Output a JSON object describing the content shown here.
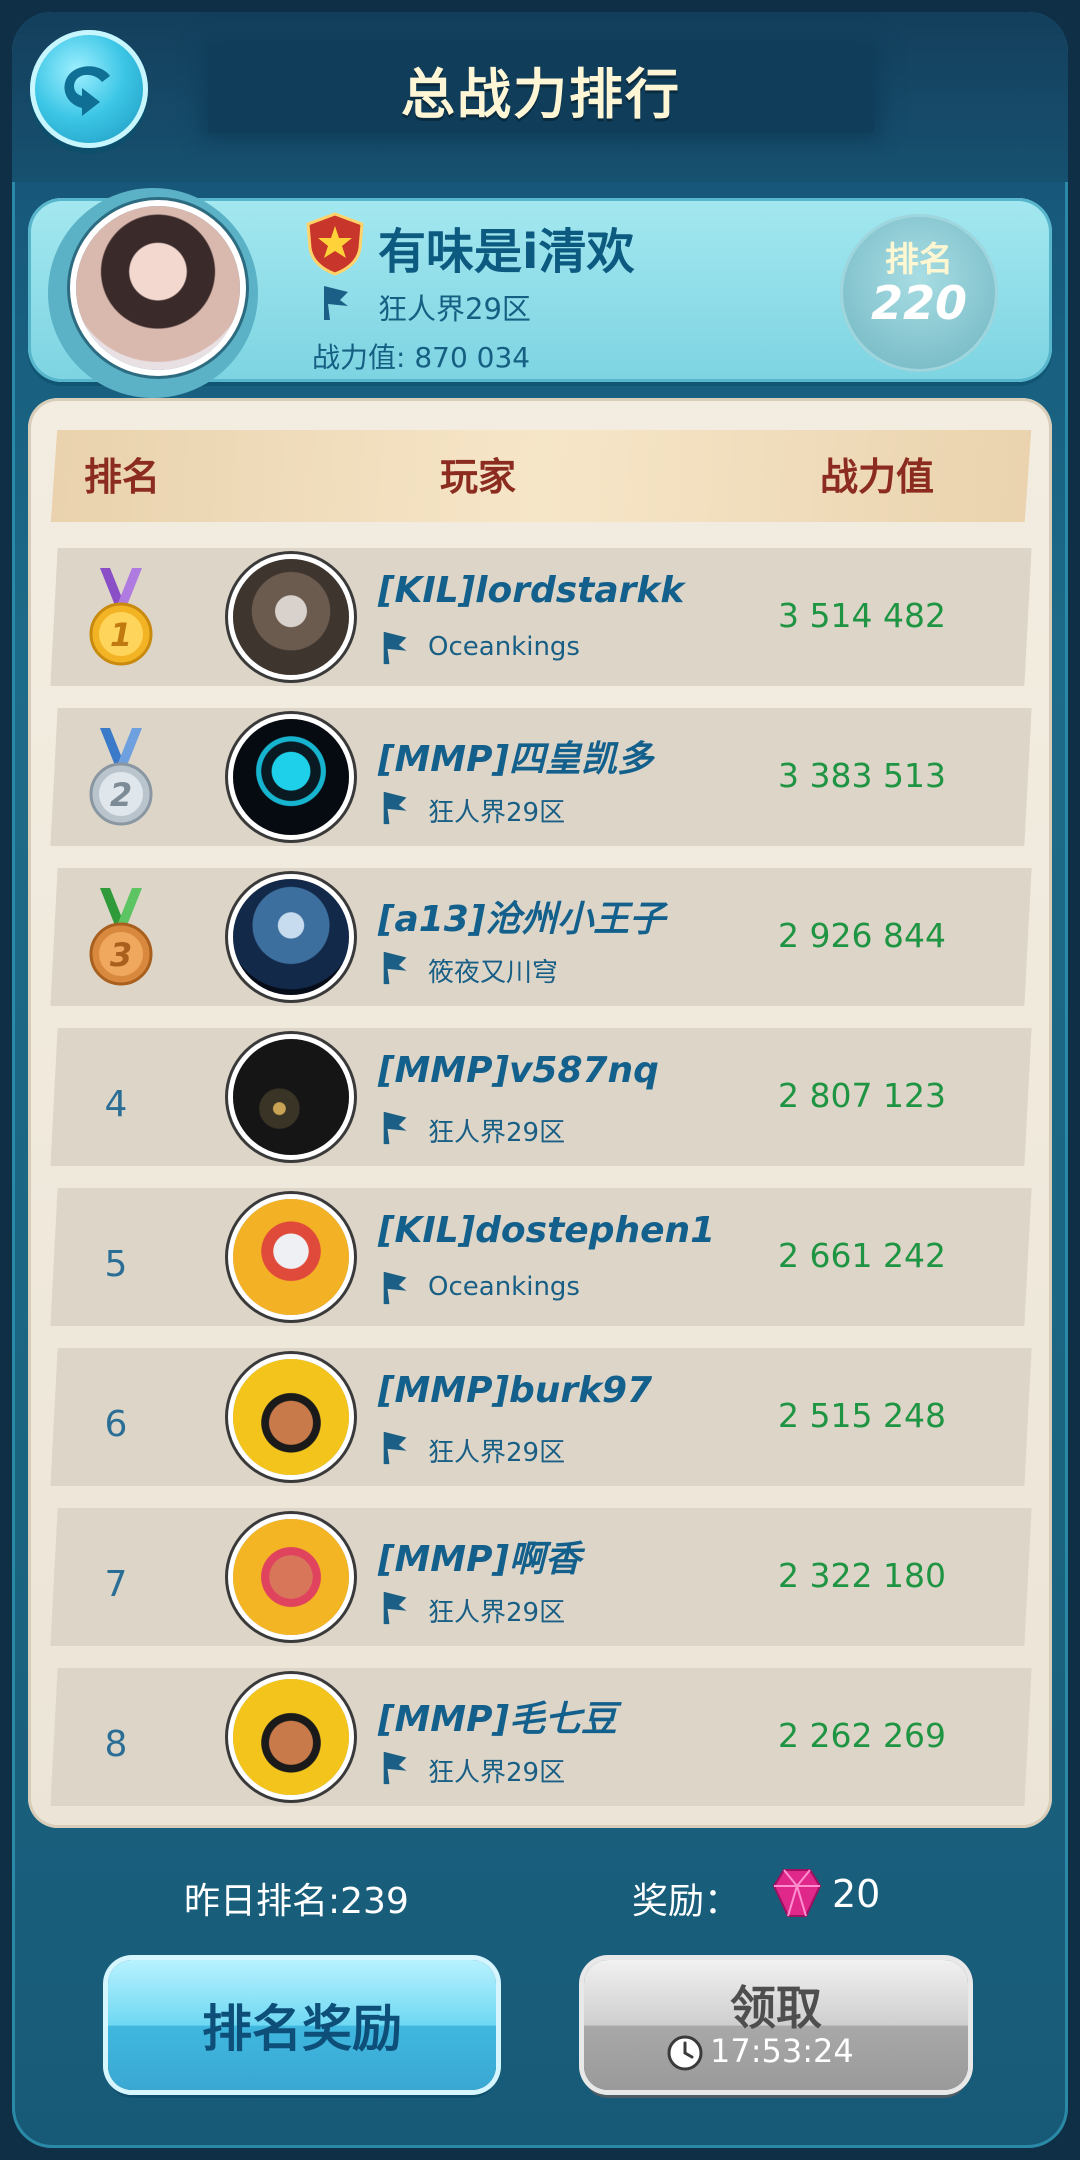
{
  "header": {
    "title": "总战力排行",
    "back_icon": "back-arrow-icon"
  },
  "me": {
    "name": "有味是i清欢",
    "server": "狂人界29区",
    "power": "战力值: 870 034",
    "rank_label": "排名",
    "rank_value": "220"
  },
  "table": {
    "headers": {
      "rank": "排名",
      "player": "玩家",
      "power": "战力值"
    },
    "rows": [
      {
        "rank": "1",
        "medal": "gold",
        "name": "[KIL]lordstarkk",
        "server": "Oceankings",
        "power": "3 514 482"
      },
      {
        "rank": "2",
        "medal": "silver",
        "name": "[MMP]四皇凯多",
        "server": "狂人界29区",
        "power": "3 383 513"
      },
      {
        "rank": "3",
        "medal": "bronze",
        "name": "[a13]沧州小王子",
        "server": "筱夜又川穹",
        "power": "2 926 844"
      },
      {
        "rank": "4",
        "medal": "",
        "name": "[MMP]v587nq",
        "server": "狂人界29区",
        "power": "2 807 123"
      },
      {
        "rank": "5",
        "medal": "",
        "name": "[KIL]dostephen1",
        "server": "Oceankings",
        "power": "2 661 242"
      },
      {
        "rank": "6",
        "medal": "",
        "name": "[MMP]burk97",
        "server": "狂人界29区",
        "power": "2 515 248"
      },
      {
        "rank": "7",
        "medal": "",
        "name": "[MMP]啊香",
        "server": "狂人界29区",
        "power": "2 322 180"
      },
      {
        "rank": "8",
        "medal": "",
        "name": "[MMP]毛七豆",
        "server": "狂人界29区",
        "power": "2 262 269"
      }
    ]
  },
  "footer": {
    "yesterday_rank": "昨日排名:239",
    "reward_label": "奖励：",
    "reward_value": "20",
    "reward_button": "排名奖励",
    "claim_button": "领取",
    "claim_timer": "17:53:24"
  },
  "colors": {
    "power_green": "#1f9442",
    "header_red": "#8c2c20",
    "name_blue": "#13608c"
  }
}
